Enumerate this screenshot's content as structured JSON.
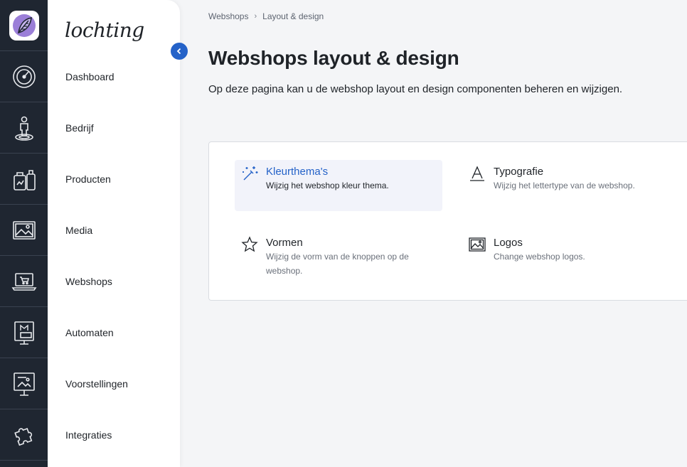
{
  "rail": {
    "icons": [
      "dashboard-gauge-icon",
      "person-pin-icon",
      "product-bottles-icon",
      "media-image-icon",
      "webshop-cart-laptop-icon",
      "automaton-monitor-icon",
      "presentation-screen-icon",
      "integrations-puzzle-icon"
    ]
  },
  "brand": {
    "name": "lochting"
  },
  "nav": {
    "items": [
      {
        "label": "Dashboard"
      },
      {
        "label": "Bedrijf"
      },
      {
        "label": "Producten"
      },
      {
        "label": "Media"
      },
      {
        "label": "Webshops"
      },
      {
        "label": "Automaten"
      },
      {
        "label": "Voorstellingen"
      },
      {
        "label": "Integraties"
      }
    ]
  },
  "breadcrumb": {
    "items": [
      "Webshops",
      "Layout & design"
    ]
  },
  "page": {
    "title": "Webshops layout & design",
    "description": "Op deze pagina kan u de webshop layout en design componenten beheren en wijzigen."
  },
  "tiles": [
    {
      "title": "Kleurthema's",
      "description": "Wijzig het webshop kleur thema."
    },
    {
      "title": "Typografie",
      "description": "Wijzig het lettertype van de webshop."
    },
    {
      "title": "Vormen",
      "description": "Wijzig de vorm van de knoppen op de webshop."
    },
    {
      "title": "Logos",
      "description": "Change webshop logos."
    }
  ],
  "colors": {
    "rail_bg": "#1f2631",
    "accent": "#2462c8",
    "logo_purple": "#9b7fd8"
  }
}
